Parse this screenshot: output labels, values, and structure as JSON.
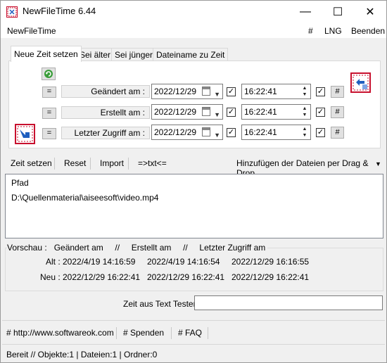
{
  "window": {
    "title": "NewFileTime 6.44",
    "controls": {
      "minimize": "—",
      "maximize": "☐",
      "close": "✕"
    }
  },
  "menubar": {
    "app_label": "NewFileTime",
    "items": [
      "#",
      "LNG",
      "Beenden"
    ]
  },
  "tabs": [
    "Neue Zeit setzen",
    "Sei älter",
    "Sei jünger",
    "Dateiname zu Zeit"
  ],
  "time_rows": [
    {
      "eq": "=",
      "label": "Geändert am :",
      "date": "2022/12/29",
      "time": "16:22:41",
      "checked": true,
      "hash": "#"
    },
    {
      "eq": "=",
      "label": "Erstellt am :",
      "date": "2022/12/29",
      "time": "16:22:41",
      "checked": true,
      "hash": "#"
    },
    {
      "eq": "=",
      "label": "Letzter Zugriff am :",
      "date": "2022/12/29",
      "time": "16:22:41",
      "checked": true,
      "hash": "#"
    }
  ],
  "actions": {
    "set_time": "Zeit setzen",
    "reset": "Reset",
    "import": "Import",
    "txt": "=>txt<=",
    "drag_drop": "Hinzufügen der Dateien per Drag & Drop"
  },
  "file_list": {
    "header": "Pfad",
    "rows": [
      "D:\\Quellenmaterial\\aiseesoft\\video.mp4"
    ]
  },
  "preview": {
    "legend": "Vorschau :   Geändert am     //     Erstellt am     //     Letzter Zugriff am",
    "alt_label": "Alt :",
    "neu_label": "Neu :",
    "alt": [
      "2022/4/19 14:16:59",
      "2022/4/19 14:16:54",
      "2022/12/29 16:16:55"
    ],
    "neu": [
      "2022/12/29 16:22:41",
      "2022/12/29 16:22:41",
      "2022/12/29 16:22:41"
    ]
  },
  "tester": {
    "label": "Zeit aus Text Tester",
    "value": ""
  },
  "links": [
    "# http://www.softwareok.com",
    "# Spenden",
    "# FAQ"
  ],
  "status": "Bereit // Objekte:1 | Dateien:1 | Ordner:0",
  "colors": {
    "icon_red": "#c8102e",
    "icon_blue": "#1f5fbf",
    "icon_green": "#3a9d3a"
  }
}
